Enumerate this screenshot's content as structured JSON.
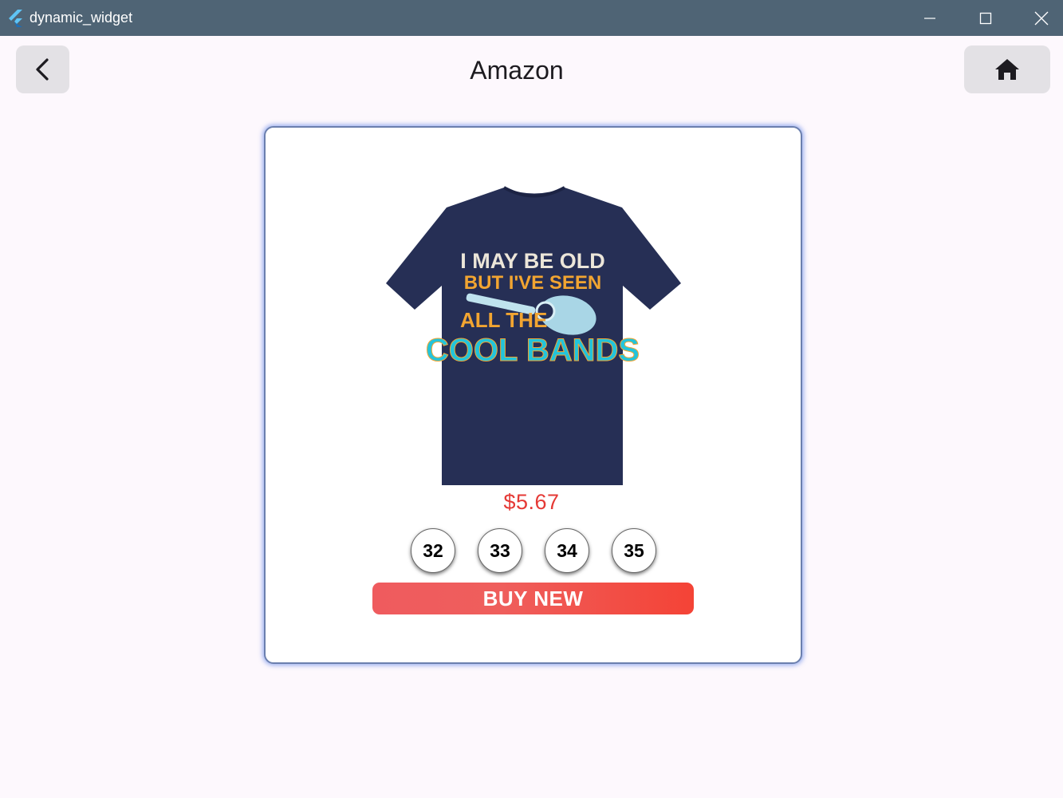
{
  "window": {
    "app_name": "dynamic_widget"
  },
  "header": {
    "title": "Amazon"
  },
  "product": {
    "price": "$5.67",
    "shirt_text": [
      "I MAY BE OLD",
      "BUT I'VE SEEN",
      "ALL THE",
      "COOL BANDS"
    ],
    "sizes": [
      "32",
      "33",
      "34",
      "35"
    ],
    "buy_label": "BUY NEW"
  },
  "colors": {
    "price": "#e53935",
    "buy_button": "#f44336",
    "titlebar": "#4f6475",
    "shirt": "#262f55"
  }
}
